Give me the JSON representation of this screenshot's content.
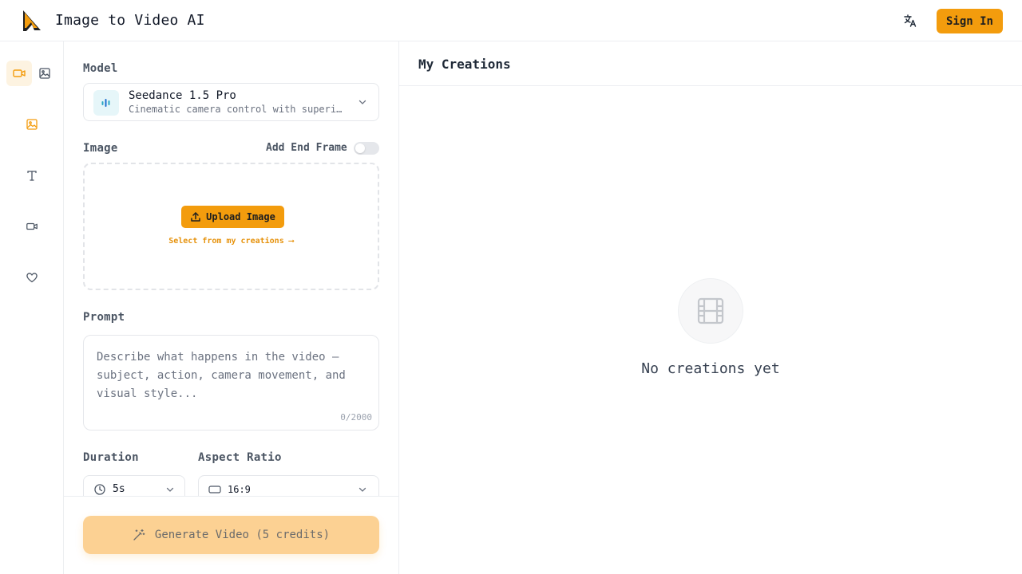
{
  "header": {
    "app_title": "Image to Video AI",
    "sign_in_label": "Sign In",
    "icons": {
      "logo": "flame-logo",
      "translate": "translate-icon"
    }
  },
  "rail": {
    "items": [
      {
        "name": "video-mode",
        "icon": "video-camera-icon",
        "active": true
      },
      {
        "name": "image-mode",
        "icon": "image-icon",
        "active": false
      },
      {
        "name": "image-to-video",
        "icon": "image-icon",
        "active": true
      },
      {
        "name": "text-to-video",
        "icon": "text-icon",
        "active": false
      },
      {
        "name": "video",
        "icon": "video-camera-icon",
        "active": false
      },
      {
        "name": "favorites",
        "icon": "heart-icon",
        "active": false
      }
    ]
  },
  "form": {
    "model_label": "Model",
    "model_name": "Seedance 1.5 Pro",
    "model_description": "Cinematic camera control with superior motion",
    "image_label": "Image",
    "end_frame_label": "Add End Frame",
    "end_frame_enabled": false,
    "upload_label": "Upload Image",
    "select_creations_label": "Select from my creations ⟶",
    "prompt_label": "Prompt",
    "prompt_value": "",
    "prompt_placeholder": "Describe what happens in the video — subject, action, camera movement, and visual style...",
    "prompt_counter": "0/2000",
    "duration_label": "Duration",
    "duration_value": "5s",
    "aspect_label": "Aspect Ratio",
    "aspect_value": "16:9",
    "generate_label": "Generate Video (5 credits)"
  },
  "creations": {
    "title": "My Creations",
    "empty_text": "No creations yet"
  },
  "colors": {
    "accent": "#f39c0d",
    "accent_soft": "#fcd193",
    "border": "#e5e7eb"
  }
}
